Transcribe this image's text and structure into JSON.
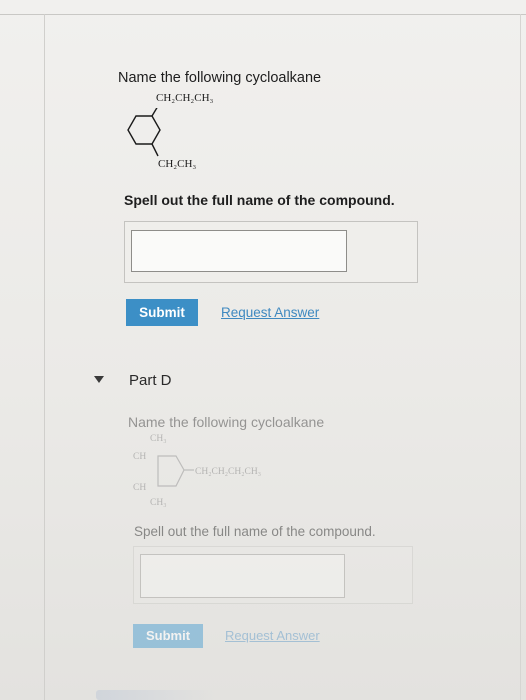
{
  "question_c": {
    "prompt": "Name the following cycloalkane",
    "substituent_top": "CH₂CH₂CH₃",
    "substituent_bottom": "CH₂CH₃",
    "instruction": "Spell out the full name of the compound.",
    "answer_value": "",
    "submit_label": "Submit",
    "request_label": "Request Answer"
  },
  "part_d": {
    "label": "Part D",
    "prompt": "Name the following cycloalkane",
    "sub_top": "CH₃",
    "sub_left_upper": "CH",
    "sub_right": "CH₂CH₂CH₂CH₃",
    "sub_left_lower": "CH",
    "sub_bottom": "CH₃",
    "instruction": "Spell out the full name of the compound.",
    "answer_value": "",
    "submit_label": "Submit",
    "request_label": "Request Answer"
  },
  "colors": {
    "submit_bg": "#3c8fc6",
    "link": "#3f89c0"
  },
  "icons": {
    "part_toggle": "caret-down-icon"
  }
}
